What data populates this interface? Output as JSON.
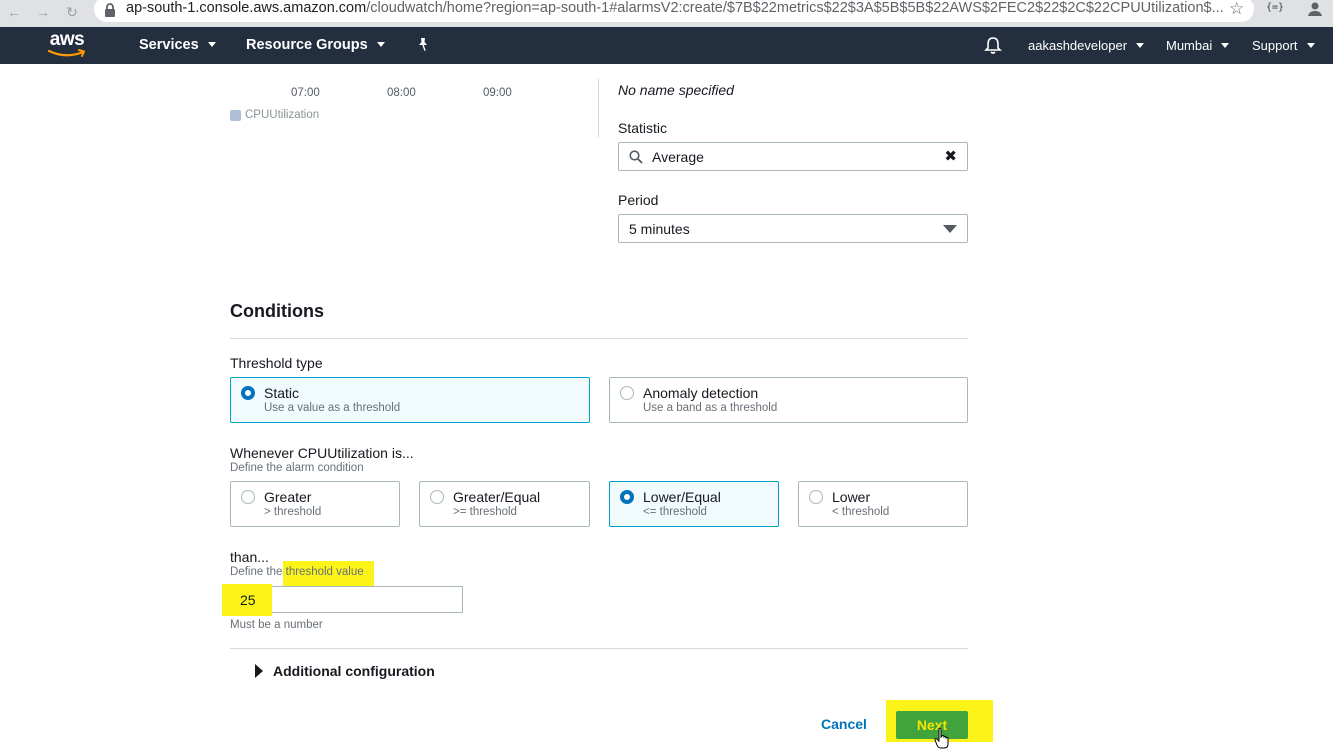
{
  "browser": {
    "url_host": "ap-south-1.console.aws.amazon.com",
    "url_path": "/cloudwatch/home?region=ap-south-1#alarmsV2:create/$7B$22metrics$22$3A$5B$5B$22AWS$2FEC2$22$2C$22CPUUtilization$...",
    "icons": [
      "back-icon",
      "forward-icon",
      "reload-icon",
      "lock-icon",
      "star-icon",
      "extension-icon",
      "profile-icon"
    ],
    "ext_label": "{=}"
  },
  "header": {
    "logo": "aws",
    "services_label": "Services",
    "resource_groups_label": "Resource Groups",
    "account_label": "aakashdeveloper",
    "region_label": "Mumbai",
    "support_label": "Support",
    "background_color": "#232f3e"
  },
  "graph": {
    "x_ticks": [
      "07:00",
      "08:00",
      "09:00"
    ],
    "legend_label": "CPUUtilization",
    "legend_color": "#aebfd7"
  },
  "metric": {
    "name_text": "No name specified",
    "statistic_label": "Statistic",
    "statistic_value": "Average",
    "period_label": "Period",
    "period_value": "5 minutes"
  },
  "conditions": {
    "title": "Conditions",
    "threshold_type_label": "Threshold type",
    "threshold_types": [
      {
        "title": "Static",
        "desc": "Use a value as a threshold",
        "selected": true
      },
      {
        "title": "Anomaly detection",
        "desc": "Use a band as a threshold",
        "selected": false
      }
    ],
    "whenever_label": "Whenever CPUUtilization is...",
    "whenever_hint": "Define the alarm condition",
    "operators": [
      {
        "title": "Greater",
        "desc": "> threshold",
        "selected": false
      },
      {
        "title": "Greater/Equal",
        "desc": ">= threshold",
        "selected": false
      },
      {
        "title": "Lower/Equal",
        "desc": "<= threshold",
        "selected": true
      },
      {
        "title": "Lower",
        "desc": "< threshold",
        "selected": false
      }
    ],
    "than_label": "than...",
    "than_hint_prefix": "Define the ",
    "than_hint_highlight": "threshold value",
    "threshold_value": "25",
    "threshold_help": "Must be a number",
    "additional_label": "Additional configuration"
  },
  "actions": {
    "cancel_label": "Cancel",
    "next_label": "Next",
    "primary_color": "#40a33c",
    "highlight_color": "#fcf418"
  }
}
